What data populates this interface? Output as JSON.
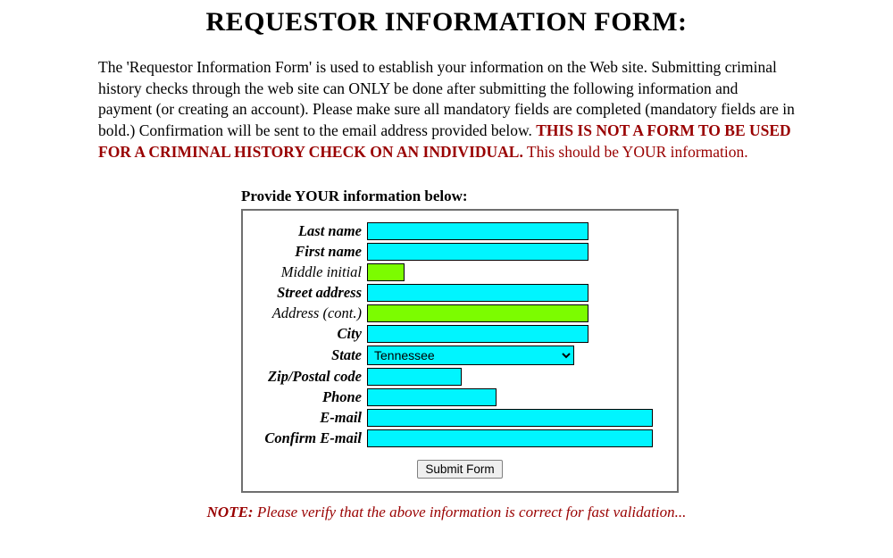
{
  "title": "REQUESTOR INFORMATION FORM:",
  "intro": {
    "text": "The 'Requestor Information Form' is used to establish your information on the Web site. Submitting criminal history checks through the web site can ONLY be done after submitting the following information and payment (or creating an account). Please make sure all mandatory fields are completed (mandatory fields are in bold.) Confirmation will be sent to the email address provided below.  ",
    "warning": "THIS IS NOT A FORM TO BE USED FOR A CRIMINAL HISTORY CHECK ON AN INDIVIDUAL.",
    "trail": " This should be YOUR information."
  },
  "form": {
    "heading": "Provide YOUR information below:",
    "fields": {
      "last_name": {
        "label": "Last name",
        "bold": true
      },
      "first_name": {
        "label": "First name",
        "bold": true
      },
      "middle_initial": {
        "label": "Middle initial",
        "bold": false
      },
      "street": {
        "label": "Street address",
        "bold": true
      },
      "address_cont": {
        "label": "Address (cont.)",
        "bold": false
      },
      "city": {
        "label": "City",
        "bold": true
      },
      "state": {
        "label": "State",
        "bold": true,
        "value": "Tennessee"
      },
      "zip": {
        "label": "Zip/Postal code",
        "bold": true
      },
      "phone": {
        "label": "Phone",
        "bold": true
      },
      "email": {
        "label": "E-mail",
        "bold": true
      },
      "confirm_email": {
        "label": "Confirm E-mail",
        "bold": true
      }
    },
    "submit_label": "Submit Form"
  },
  "note": {
    "prefix": "NOTE:",
    "text": " Please verify that the above information is correct for fast validation..."
  }
}
